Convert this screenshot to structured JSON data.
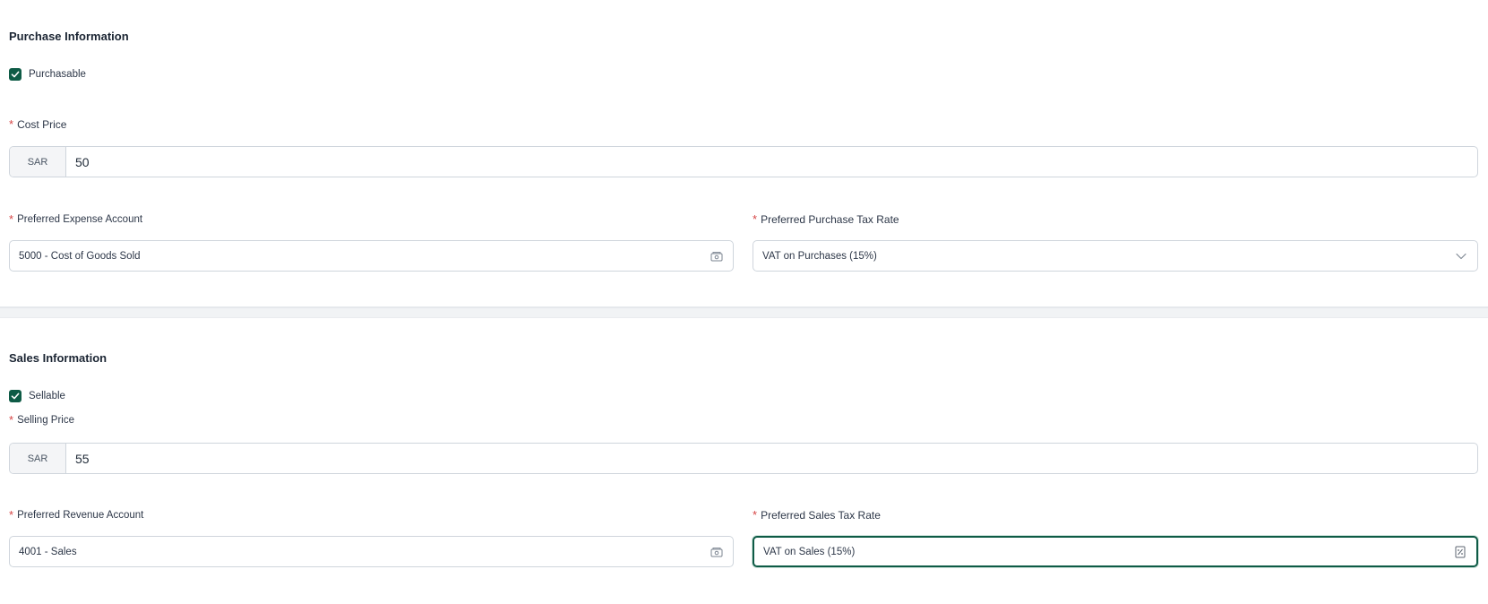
{
  "purchase": {
    "title": "Purchase Information",
    "purchasable_label": "Purchasable",
    "cost_price_label": "Cost Price",
    "cost_currency": "SAR",
    "cost_value": "50",
    "expense_account_label": "Preferred Expense Account",
    "expense_account_value": "5000 - Cost of Goods Sold",
    "tax_rate_label": "Preferred Purchase Tax Rate",
    "tax_rate_value": "VAT on Purchases (15%)"
  },
  "sales": {
    "title": "Sales Information",
    "sellable_label": "Sellable",
    "selling_price_label": "Selling Price",
    "selling_currency": "SAR",
    "selling_value": "55",
    "revenue_account_label": "Preferred Revenue Account",
    "revenue_account_value": "4001 - Sales",
    "tax_rate_label": "Preferred Sales Tax Rate",
    "tax_rate_value": "VAT on Sales (15%)"
  },
  "required_marker": "*",
  "colors": {
    "accent": "#0e5b46",
    "required": "#d64545",
    "border": "#cfd5dc"
  },
  "icons": {
    "checkbox": "check-icon",
    "account_picker": "account-picker-icon",
    "dropdown": "chevron-down-icon",
    "tax_rate": "percent-icon"
  }
}
